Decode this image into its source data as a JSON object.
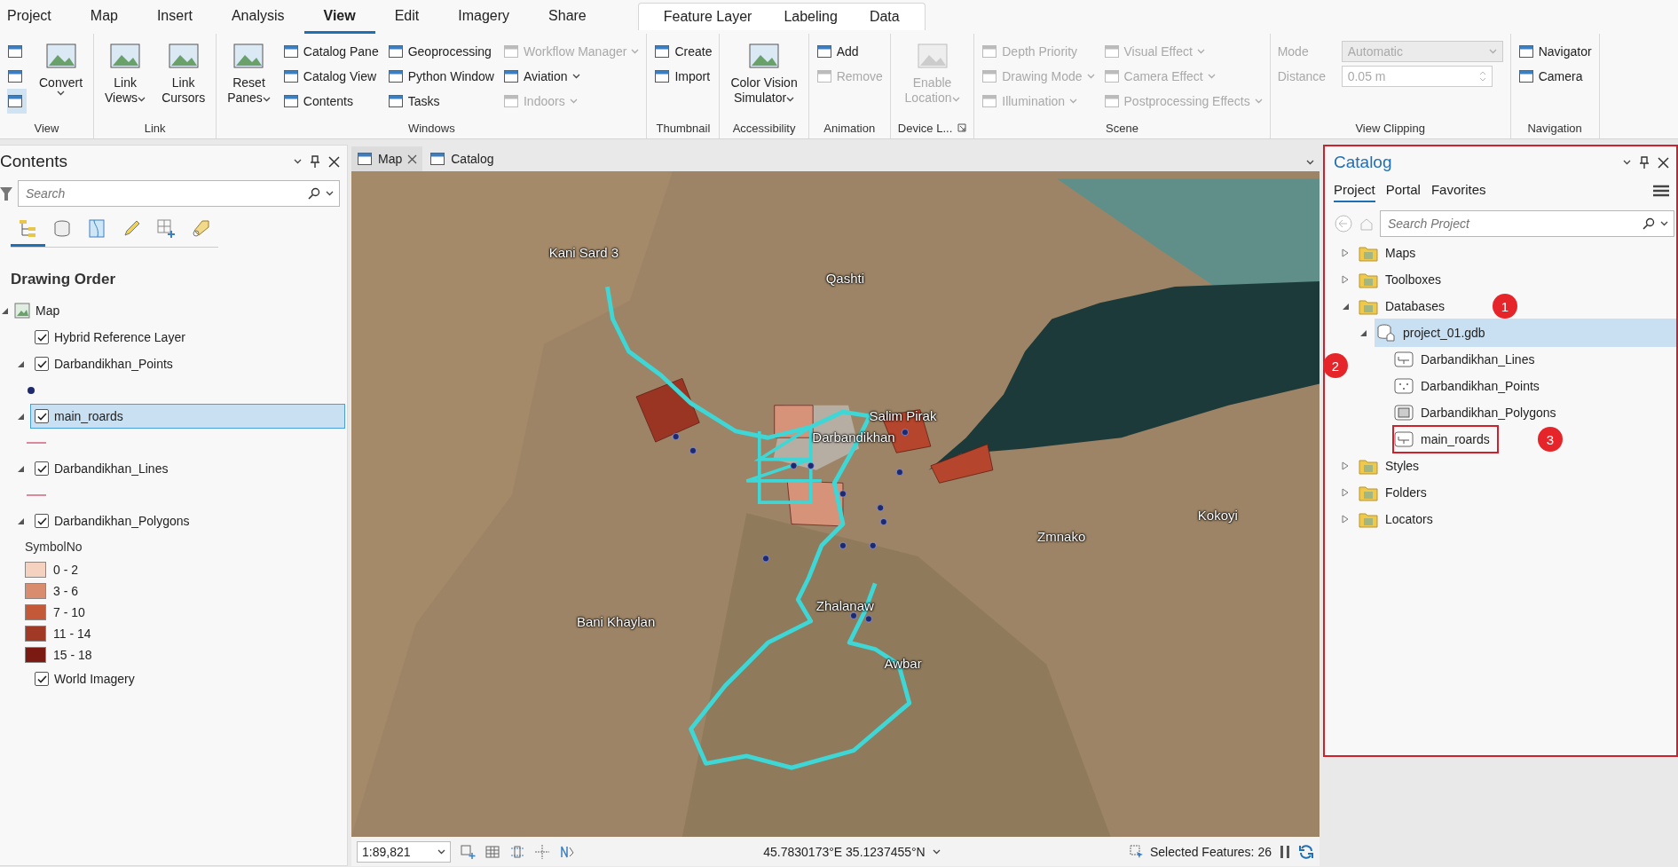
{
  "menu_tabs": [
    {
      "label": "Project",
      "selected": false
    },
    {
      "label": "Map",
      "selected": false
    },
    {
      "label": "Insert",
      "selected": false
    },
    {
      "label": "Analysis",
      "selected": false
    },
    {
      "label": "View",
      "selected": true
    },
    {
      "label": "Edit",
      "selected": false
    },
    {
      "label": "Imagery",
      "selected": false
    },
    {
      "label": "Share",
      "selected": false
    }
  ],
  "contextual_tabs": [
    {
      "label": "Feature Layer",
      "selected": false
    },
    {
      "label": "Labeling",
      "selected": false
    },
    {
      "label": "Data",
      "selected": false
    }
  ],
  "ribbon": {
    "groups": [
      {
        "label": "View",
        "items": [
          {
            "kind": "icon"
          },
          {
            "kind": "icon"
          },
          {
            "kind": "icon",
            "selected": true
          },
          {
            "kind": "large",
            "lines": [
              "Convert"
            ],
            "caret": true,
            "disabled": false
          }
        ]
      },
      {
        "label": "Link",
        "items": [
          {
            "kind": "large",
            "lines": [
              "Link",
              "Views"
            ],
            "caret": true,
            "disabled": false
          },
          {
            "kind": "large",
            "lines": [
              "Link",
              "Cursors"
            ],
            "caret": false,
            "disabled": false
          }
        ]
      },
      {
        "label": "Windows",
        "items": [
          {
            "kind": "large",
            "lines": [
              "Reset",
              "Panes"
            ],
            "caret": true,
            "disabled": false
          },
          {
            "kind": "small",
            "label": "Catalog Pane",
            "caret": false,
            "disabled": false
          },
          {
            "kind": "small",
            "label": "Catalog View",
            "caret": false,
            "disabled": false
          },
          {
            "kind": "small",
            "label": "Contents",
            "caret": false,
            "disabled": false
          },
          {
            "kind": "small",
            "label": "Geoprocessing",
            "caret": false,
            "disabled": false
          },
          {
            "kind": "small",
            "label": "Python Window",
            "caret": false,
            "disabled": false
          },
          {
            "kind": "small",
            "label": "Tasks",
            "caret": false,
            "disabled": false
          },
          {
            "kind": "small",
            "label": "Workflow Manager",
            "caret": true,
            "disabled": true
          },
          {
            "kind": "small",
            "label": "Aviation",
            "caret": true,
            "disabled": false
          },
          {
            "kind": "small",
            "label": "Indoors",
            "caret": true,
            "disabled": true
          }
        ]
      },
      {
        "label": "Thumbnail",
        "items": [
          {
            "kind": "small",
            "label": "Create",
            "caret": false,
            "disabled": false
          },
          {
            "kind": "small",
            "label": "Import",
            "caret": false,
            "disabled": false
          }
        ]
      },
      {
        "label": "Accessibility",
        "items": [
          {
            "kind": "large",
            "lines": [
              "Color Vision",
              "Simulator"
            ],
            "caret": true,
            "disabled": false
          }
        ]
      },
      {
        "label": "Animation",
        "items": [
          {
            "kind": "small",
            "label": "Add",
            "caret": false,
            "disabled": false
          },
          {
            "kind": "small",
            "label": "Remove",
            "caret": false,
            "disabled": true
          }
        ]
      },
      {
        "label": "Device L...",
        "launcher": true,
        "items": [
          {
            "kind": "large",
            "lines": [
              "Enable",
              "Location"
            ],
            "caret": true,
            "disabled": true
          }
        ]
      },
      {
        "label": "Scene",
        "items": [
          {
            "kind": "small",
            "label": "Depth Priority",
            "caret": false,
            "disabled": true
          },
          {
            "kind": "small",
            "label": "Drawing Mode",
            "caret": true,
            "disabled": true
          },
          {
            "kind": "small",
            "label": "Illumination",
            "caret": true,
            "disabled": true
          },
          {
            "kind": "small",
            "label": "Visual Effect",
            "caret": true,
            "disabled": true
          },
          {
            "kind": "small",
            "label": "Camera Effect",
            "caret": true,
            "disabled": true
          },
          {
            "kind": "small",
            "label": "Postprocessing Effects",
            "caret": true,
            "disabled": true
          }
        ]
      },
      {
        "label": "View Clipping",
        "items": [
          {
            "kind": "dropdown",
            "label": "Mode",
            "value": "Automatic",
            "disabled": true
          },
          {
            "kind": "spin",
            "label": "Distance",
            "value": "0.05  m",
            "disabled": true
          }
        ]
      },
      {
        "label": "Navigation",
        "items": [
          {
            "kind": "small",
            "label": "Navigator",
            "caret": false,
            "disabled": false
          },
          {
            "kind": "small",
            "label": "Camera",
            "caret": false,
            "disabled": false
          }
        ]
      }
    ]
  },
  "contents": {
    "title": "Contents",
    "search": {
      "placeholder": "Search"
    },
    "tools": [
      {
        "selected": true
      },
      {
        "selected": false
      },
      {
        "selected": false
      },
      {
        "selected": false
      },
      {
        "selected": false
      },
      {
        "selected": false
      }
    ],
    "heading": "Drawing Order",
    "tree": [
      {
        "label": "Map",
        "expanded": true,
        "children": [
          {
            "label": "Hybrid Reference Layer",
            "checked": true,
            "selected": false
          },
          {
            "label": "Darbandikhan_Points",
            "checked": true,
            "expanded": true,
            "selected": false,
            "legend": {
              "kind": "point",
              "color": "#1f2a6e"
            }
          },
          {
            "label": "main_roards",
            "checked": true,
            "expanded": true,
            "selected": true,
            "legend": {
              "kind": "line",
              "color": "#d98a9c"
            }
          },
          {
            "label": "Darbandikhan_Lines",
            "checked": true,
            "expanded": true,
            "selected": false,
            "legend": {
              "kind": "line",
              "color": "#d98a9c"
            }
          },
          {
            "label": "Darbandikhan_Polygons",
            "checked": true,
            "expanded": true,
            "selected": false,
            "legend": {
              "kind": "classes",
              "title": "SymbolNo",
              "classes": [
                {
                  "label": "0 - 2",
                  "color": "#f5d2c0"
                },
                {
                  "label": "3 - 6",
                  "color": "#d98c6e"
                },
                {
                  "label": "7 - 10",
                  "color": "#c4593a"
                },
                {
                  "label": "11 - 14",
                  "color": "#a03a26"
                },
                {
                  "label": "15 - 18",
                  "color": "#7a1a12"
                }
              ]
            }
          },
          {
            "label": "World Imagery",
            "checked": true,
            "selected": false
          }
        ]
      }
    ]
  },
  "view_tabs": [
    {
      "label": "Map",
      "selected": true,
      "closable": true
    },
    {
      "label": "Catalog",
      "selected": false,
      "closable": false
    }
  ],
  "map": {
    "labels": [
      "Kani Sard 3",
      "Qashti",
      "Salim Pirak",
      "Darbandikhan",
      "Zmnako",
      "Kokoyi",
      "Bani Khaylan",
      "Zhalanaw",
      "Awbar"
    ]
  },
  "status_bar": {
    "scale": "1:89,821",
    "coordinates": "45.7830173°E 35.1237455°N",
    "selected_features": "Selected Features: 26"
  },
  "catalog": {
    "title": "Catalog",
    "outlined": true,
    "tabs": [
      {
        "label": "Project",
        "selected": true
      },
      {
        "label": "Portal",
        "selected": false
      },
      {
        "label": "Favorites",
        "selected": false
      }
    ],
    "search": {
      "placeholder": "Search Project"
    },
    "tree": [
      {
        "label": "Maps",
        "kind": "folder",
        "expanded": false,
        "selected": false
      },
      {
        "label": "Toolboxes",
        "kind": "folder",
        "expanded": false,
        "selected": false
      },
      {
        "label": "Databases",
        "kind": "folder",
        "expanded": true,
        "selected": false,
        "badge": "1",
        "children": [
          {
            "label": "project_01.gdb",
            "kind": "gdb",
            "expanded": true,
            "selected": true,
            "badge": "2",
            "children": [
              {
                "label": "Darbandikhan_Lines",
                "kind": "line",
                "selected": false
              },
              {
                "label": "Darbandikhan_Points",
                "kind": "point",
                "selected": false
              },
              {
                "label": "Darbandikhan_Polygons",
                "kind": "polygon",
                "selected": false
              },
              {
                "label": "main_roards",
                "kind": "line",
                "selected": false,
                "outlined": true,
                "badge": "3"
              }
            ]
          }
        ]
      },
      {
        "label": "Styles",
        "kind": "folder",
        "expanded": false,
        "selected": false
      },
      {
        "label": "Folders",
        "kind": "folder",
        "expanded": false,
        "selected": false
      },
      {
        "label": "Locators",
        "kind": "folder",
        "expanded": false,
        "selected": false
      }
    ]
  }
}
